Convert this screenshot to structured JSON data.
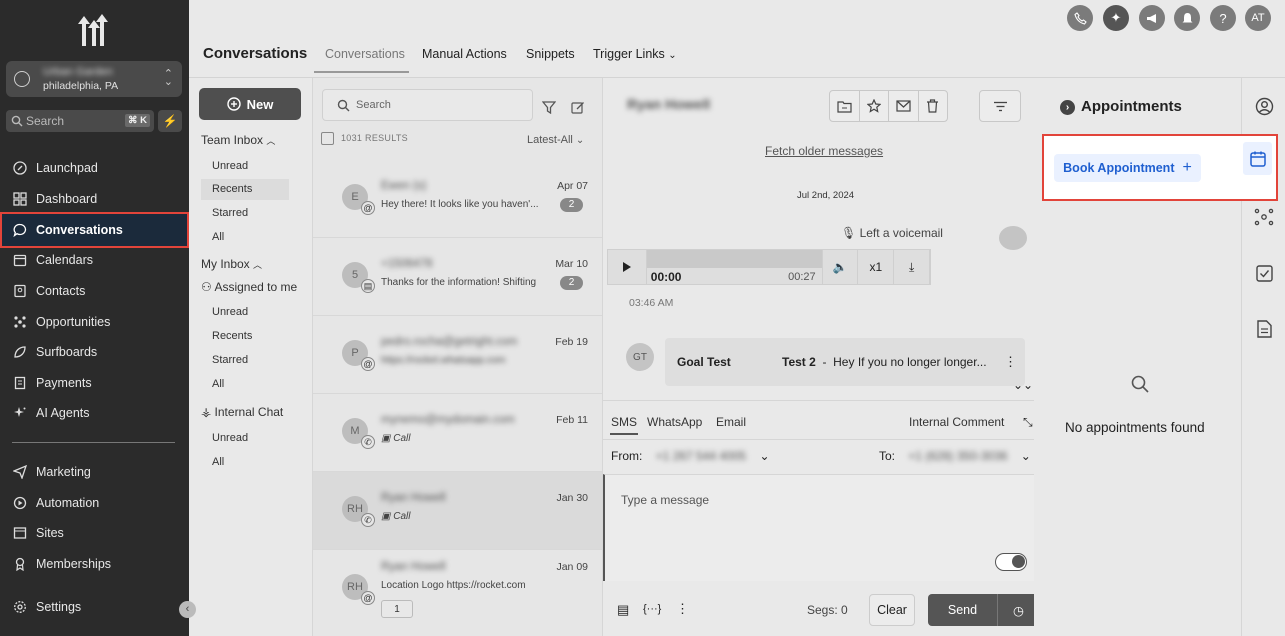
{
  "sidebar": {
    "account": {
      "name": "Urban Garden",
      "location": "philadelphia, PA"
    },
    "search": {
      "label": "Search",
      "shortcut": "⌘ K"
    },
    "items": [
      {
        "label": "Launchpad",
        "icon": "rocket-icon"
      },
      {
        "label": "Dashboard",
        "icon": "grid-icon"
      },
      {
        "label": "Conversations",
        "icon": "chat-icon",
        "active": true
      },
      {
        "label": "Calendars",
        "icon": "calendar-icon"
      },
      {
        "label": "Contacts",
        "icon": "contacts-icon"
      },
      {
        "label": "Opportunities",
        "icon": "opportunities-icon"
      },
      {
        "label": "Surfboards",
        "icon": "surfboard-icon"
      },
      {
        "label": "Payments",
        "icon": "payments-icon"
      },
      {
        "label": "AI Agents",
        "icon": "sparkle-icon"
      },
      {
        "label": "Marketing",
        "icon": "send-icon"
      },
      {
        "label": "Automation",
        "icon": "automation-icon"
      },
      {
        "label": "Sites",
        "icon": "sites-icon"
      },
      {
        "label": "Memberships",
        "icon": "membership-icon"
      },
      {
        "label": "Settings",
        "icon": "gear-icon"
      }
    ]
  },
  "header": {
    "title": "Conversations",
    "tabs": [
      "Conversations",
      "Manual Actions",
      "Snippets",
      "Trigger Links"
    ],
    "user_initials": "AT"
  },
  "inbox": {
    "new_label": "New",
    "team_inbox": "Team Inbox",
    "team_items": [
      "Unread",
      "Recents",
      "Starred",
      "All"
    ],
    "my_inbox": "My Inbox",
    "assigned": "Assigned to me",
    "my_items": [
      "Unread",
      "Recents",
      "Starred",
      "All"
    ],
    "internal_chat": "Internal Chat",
    "chat_items": [
      "Unread",
      "All"
    ]
  },
  "list": {
    "search_placeholder": "Search",
    "results": "1031 RESULTS",
    "sort": "Latest-All",
    "conversations": [
      {
        "initials": "E",
        "name": "Ewen (s)",
        "preview": "Hey there!  It looks like you haven'...",
        "date": "Apr 07",
        "count": "2"
      },
      {
        "initials": "5",
        "name": "+1506478",
        "preview": "Thanks for the information! Shifting",
        "date": "Mar 10",
        "count": "2"
      },
      {
        "initials": "P",
        "name": "pedro.rocha@getright.com",
        "preview": "https://rocket.whatsapp.com",
        "date": "Feb 19",
        "count": ""
      },
      {
        "initials": "M",
        "name": "mynemo@mydomain.com",
        "preview": "Call",
        "date": "Feb 11",
        "count": ""
      },
      {
        "initials": "RH",
        "name": "Ryan Howell",
        "preview": "Call",
        "date": "Jan 30",
        "count": ""
      },
      {
        "initials": "RH",
        "name": "Ryan Howell",
        "preview": "Location Logo https://rocket.com",
        "date": "Jan 09",
        "count": "1"
      }
    ]
  },
  "thread": {
    "contact": "Ryan Howell",
    "fetch_older": "Fetch older messages",
    "date": "Jul 2nd, 2024",
    "voicemail_label": "Left a voicemail",
    "audio": {
      "current": "00:00",
      "duration": "00:27",
      "speed": "x1"
    },
    "voicemail_time": "03:46 AM",
    "message": {
      "initials": "GT",
      "sender": "Goal Test",
      "subject": "Test 2",
      "separator": "-",
      "body": "Hey If you no longer longer..."
    },
    "compose": {
      "tabs": [
        "SMS",
        "WhatsApp",
        "Email"
      ],
      "internal": "Internal Comment",
      "from_label": "From:",
      "from_value": "+1 267 544 4005",
      "to_label": "To:",
      "to_value": "+1 (628) 350-3036",
      "placeholder": "Type a message",
      "segs": "Segs: 0",
      "clear": "Clear",
      "send": "Send"
    }
  },
  "appointments": {
    "title": "Appointments",
    "book": "Book Appointment",
    "empty": "No appointments found"
  }
}
